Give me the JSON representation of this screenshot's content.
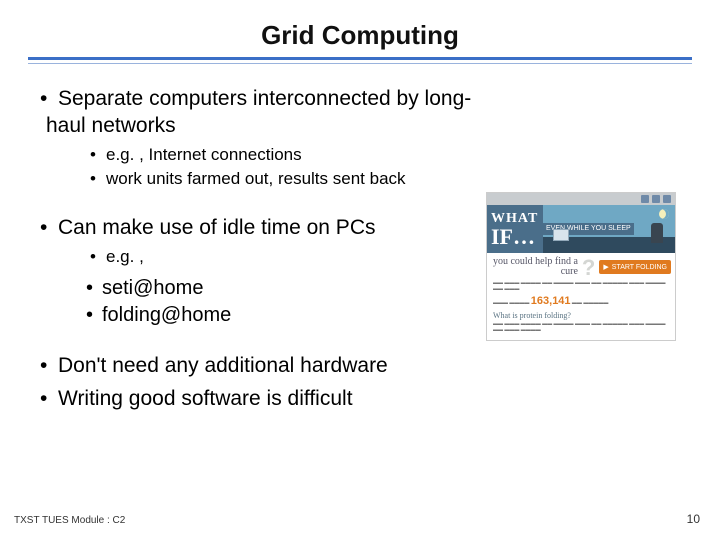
{
  "title": "Grid Computing",
  "bullets": {
    "b1": "Separate computers interconnected by long-haul networks",
    "b1_sub": {
      "a": "e.g. , Internet connections",
      "b": "work units farmed out, results sent back"
    },
    "b2": "Can make use of idle time on PCs",
    "b2_sub": {
      "a": "e.g. ,"
    },
    "b2_sub2": {
      "a": "seti@home",
      "b": "folding@home"
    },
    "b3": "Don't need any additional hardware",
    "b4": "Writing good software is difficult"
  },
  "promo": {
    "what": "WHAT",
    "if": "IF…",
    "banner": "EVEN WHILE YOU SLEEP",
    "cure": "you could help find a cure",
    "start": "START FOLDING",
    "number": "163,141",
    "subhead": "What is protein folding?"
  },
  "footer": {
    "left": "TXST TUES Module : C2",
    "right": "10"
  }
}
